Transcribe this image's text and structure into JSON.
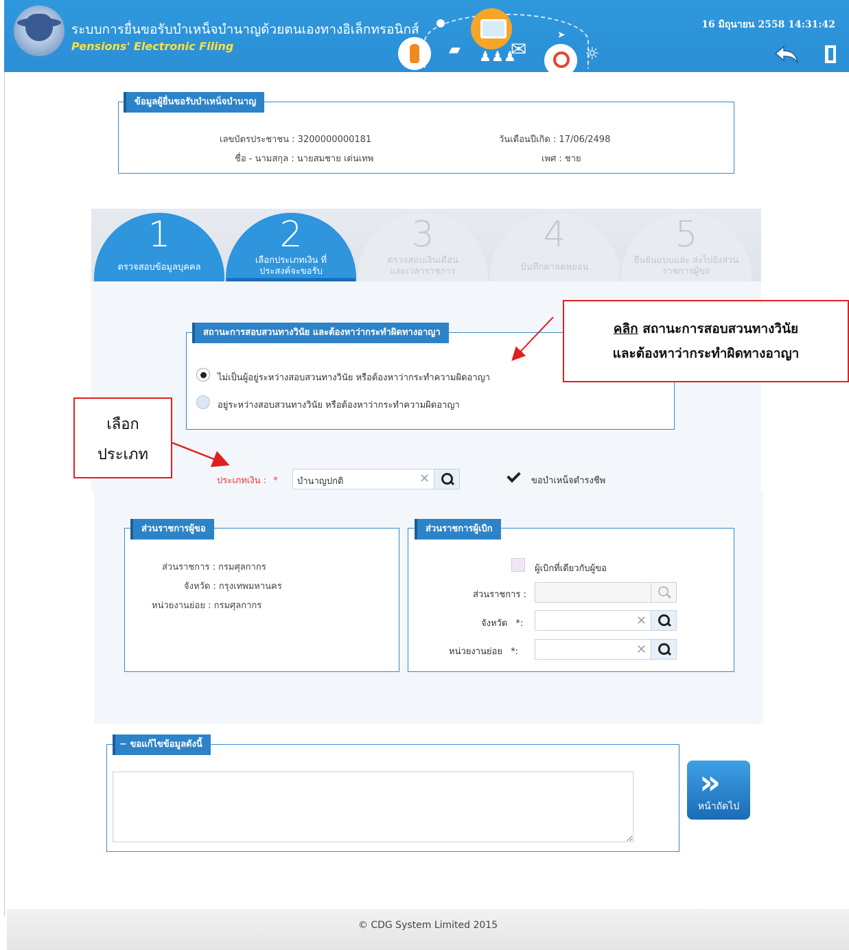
{
  "header": {
    "title": "ระบบการยื่นขอรับบำเหน็จบำนาญด้วยตนเองทางอิเล็กทรอนิกส์",
    "subtitle": "Pensions' Electronic Filing",
    "datetime": "16 มิถุนายน 2558 14:31:42"
  },
  "applicant": {
    "legend": "ข้อมูลผู้ยื่นขอรับบำเหน็จบำนาญ",
    "id_label": "เลขบัตรประชาชน : 3200000000181",
    "birth_label": "วันเดือนปีเกิด : 17/06/2498",
    "name_label": "ชื่อ - นามสกุล : นายสมชาย เด่นเทพ",
    "sex_label": "เพศ : ชาย"
  },
  "wizard": {
    "steps": [
      {
        "num": "1",
        "label": "ตรวจสอบข้อมูลบุคคล",
        "state": "active"
      },
      {
        "num": "2",
        "label": "เลือกประเภทเงิน ที่ประสงค์จะขอรับ",
        "state": "active"
      },
      {
        "num": "3",
        "label": "ตรวจสอบเงินเดือน และเวลาราชการ",
        "state": "disabled"
      },
      {
        "num": "4",
        "label": "บันทึกค่าลดหย่อน",
        "state": "disabled"
      },
      {
        "num": "5",
        "label": "ยืนยันแบบและ ส่งไปยังส่วนราชการผู้ขอ",
        "state": "disabled"
      }
    ]
  },
  "investigation": {
    "legend": "สถานะการสอบสวนทางวินัย และต้องหาว่ากระทำผิดทางอาญา",
    "options": [
      {
        "label": "ไม่เป็นผู้อยู่ระหว่างสอบสวนทางวินัย หรือต้องหาว่ากระทำความผิดอาญา",
        "checked": true
      },
      {
        "label": "อยู่ระหว่างสอบสวนทางวินัย หรือต้องหาว่ากระทำความผิดอาญา",
        "checked": false
      }
    ]
  },
  "money_type": {
    "label": "ประเภทเงิน :",
    "required": "*",
    "value": "บำนาญปกติ",
    "pension_checkbox_label": "ขอบำเหน็จดำรงชีพ",
    "pension_checked": true
  },
  "requester_agency": {
    "legend": "ส่วนราชการผู้ขอ",
    "agency": "ส่วนราชการ : กรมศุลกากร",
    "province": "จังหวัด : กรุงเทพมหานคร",
    "unit": "หน่วยงานย่อย : กรมศุลกากร"
  },
  "payer_agency": {
    "legend": "ส่วนราชการผู้เบิก",
    "same_checkbox_label": "ผู้เบิกที่เดียวกับผู้ขอ",
    "agency_label": "ส่วนราชการ :",
    "province_label": "จังหวัด",
    "unit_label": "หน่วยงานย่อย",
    "required": "*",
    "colon": ":"
  },
  "edit_request": {
    "legend": "ขอแก้ไขข้อมูลดังนี้",
    "collapse_symbol": "−"
  },
  "next_button": {
    "label": "หน้าถัดไป"
  },
  "callouts": {
    "click_underlined": "คลิก",
    "click_line1_rest": " สถานะการสอบสวนทางวินัย",
    "click_line2": "และต้องหาว่ากระทำผิดทางอาญา",
    "select_line1": "เลือก",
    "select_line2": "ประเภท"
  },
  "footer": {
    "text": "© CDG System Limited 2015"
  },
  "colors": {
    "header_blue": "#2b8fd6",
    "accent_orange": "#f7a529",
    "callout_red": "#e02020",
    "subtitle_yellow": "#ffe03a"
  }
}
